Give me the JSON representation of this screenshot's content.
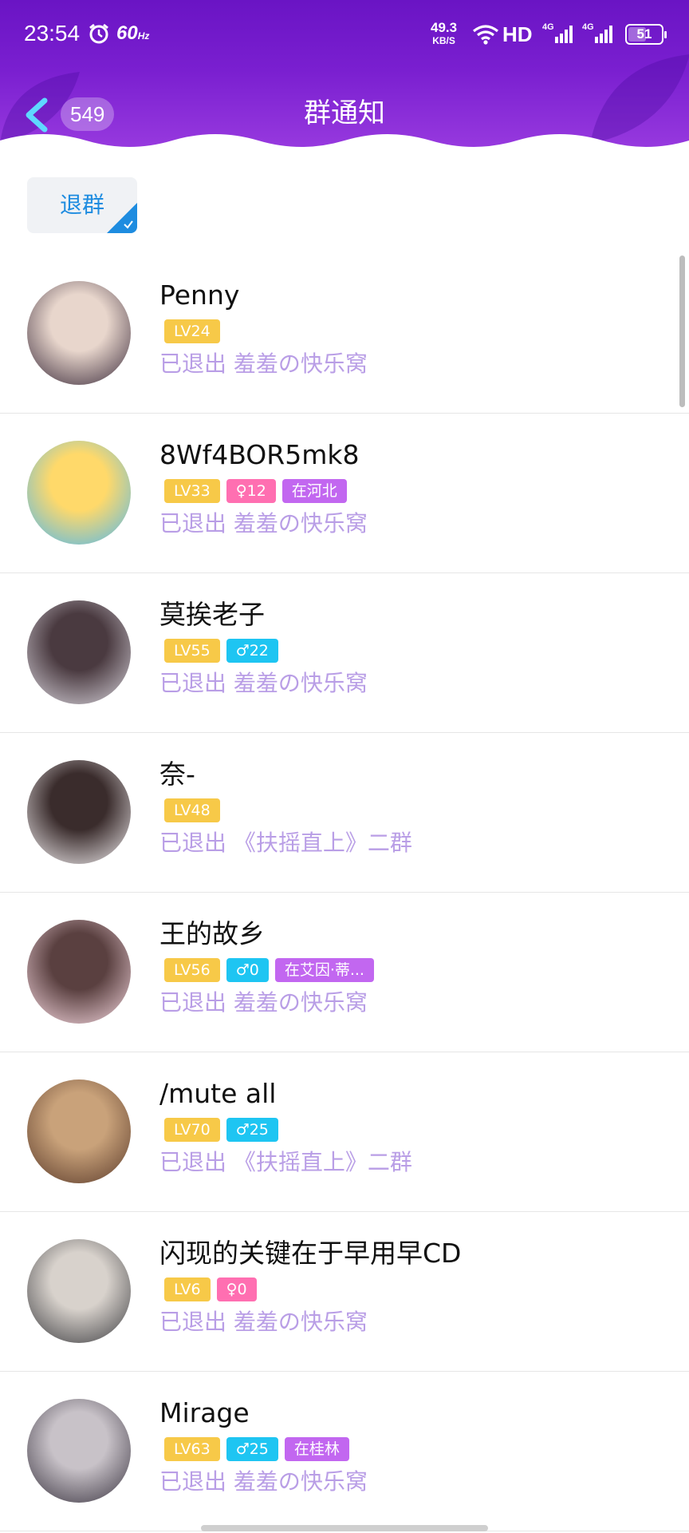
{
  "status_bar": {
    "time": "23:54",
    "refresh_rate": "60",
    "refresh_unit": "Hz",
    "net_speed": "49.3",
    "net_speed_unit": "KB/S",
    "hd_label": "HD",
    "signal_1_label": "4G",
    "signal_2_label": "4G",
    "battery": "51"
  },
  "header": {
    "back_count": "549",
    "title": "群通知"
  },
  "filter": {
    "label": "退群",
    "selected": true
  },
  "colors": {
    "header": "#7a1fd0",
    "filter_text": "#1e8ce0",
    "status_text": "#b99ee6",
    "level_badge": "#f7c948",
    "female_badge": "#ff6fb1",
    "male_badge": "#1ec5f2",
    "location_badge": "#c267f0"
  },
  "members": [
    {
      "name": "Penny",
      "level": "LV24",
      "gender_badge": "",
      "location": "",
      "status": "已退出 羞羞の快乐窝",
      "avatar_colors": [
        "#3a2a3a",
        "#e8d6cc"
      ]
    },
    {
      "name": "8Wf4BOR5mk8",
      "level": "LV33",
      "gender_badge": "♀12",
      "gender": "female",
      "location": "在河北",
      "status": "已退出 羞羞の快乐窝",
      "avatar_colors": [
        "#4fb8f0",
        "#ffd96a"
      ]
    },
    {
      "name": "莫挨老子",
      "level": "LV55",
      "gender_badge": "♂22",
      "gender": "male",
      "location": "",
      "status": "已退出 羞羞の快乐窝",
      "avatar_colors": [
        "#d8d4dc",
        "#4a3a40"
      ]
    },
    {
      "name": "奈-",
      "level": "LV48",
      "gender_badge": "",
      "location": "",
      "status": "已退出 《扶摇直上》二群",
      "avatar_colors": [
        "#f2eef0",
        "#3a2c2c"
      ]
    },
    {
      "name": "王的故乡",
      "level": "LV56",
      "gender_badge": "♂0",
      "gender": "male",
      "location": "在艾因·蒂...",
      "status": "已退出 羞羞の快乐窝",
      "avatar_colors": [
        "#f6d8e0",
        "#5a4040"
      ]
    },
    {
      "name": "/mute all",
      "level": "LV70",
      "gender_badge": "♂25",
      "gender": "male",
      "location": "",
      "status": "已退出 《扶摇直上》二群",
      "avatar_colors": [
        "#5a3a2a",
        "#c9a27a"
      ]
    },
    {
      "name": "闪现的关键在于早用早CD",
      "level": "LV6",
      "gender_badge": "♀0",
      "gender": "female",
      "location": "",
      "status": "已退出 羞羞の快乐窝",
      "avatar_colors": [
        "#3c3c40",
        "#d8d2cc"
      ]
    },
    {
      "name": "Mirage",
      "level": "LV63",
      "gender_badge": "♂25",
      "gender": "male",
      "location": "在桂林",
      "status": "已退出 羞羞の快乐窝",
      "avatar_colors": [
        "#3a3440",
        "#c8c2c8"
      ]
    }
  ]
}
